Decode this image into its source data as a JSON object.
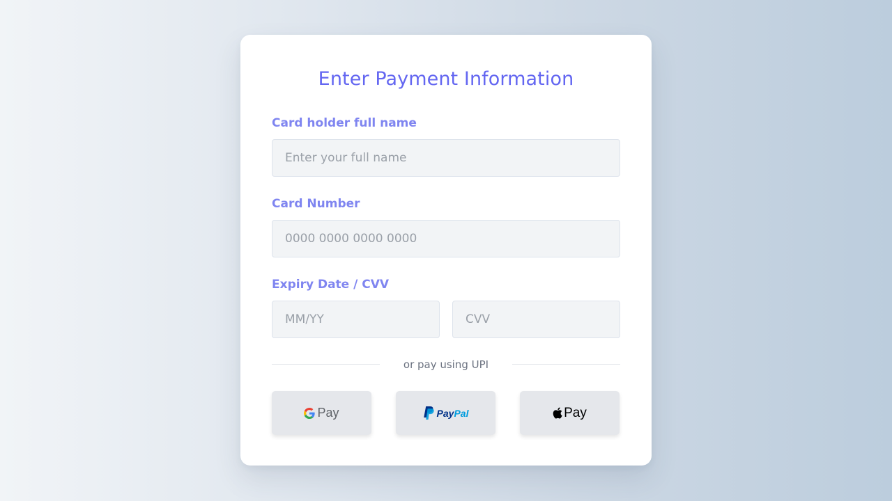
{
  "form": {
    "title": "Enter Payment Information",
    "name_label": "Card holder full name",
    "name_placeholder": "Enter your full name",
    "card_label": "Card Number",
    "card_placeholder": "0000 0000 0000 0000",
    "expiry_cvv_label": "Expiry Date / CVV",
    "expiry_placeholder": "MM/YY",
    "cvv_placeholder": "CVV",
    "divider_text": "or pay using UPI"
  },
  "upi": {
    "gpay_label": "Pay",
    "gpay_icon": "google-g-icon",
    "paypal_label_pay": "Pay",
    "paypal_label_pal": "Pal",
    "paypal_icon": "paypal-icon",
    "applepay_label": "Pay",
    "applepay_icon": "apple-icon"
  },
  "colors": {
    "accent": "#6366f1",
    "label": "#7f85f0",
    "paypal_dark": "#003087",
    "paypal_light": "#009cde"
  }
}
